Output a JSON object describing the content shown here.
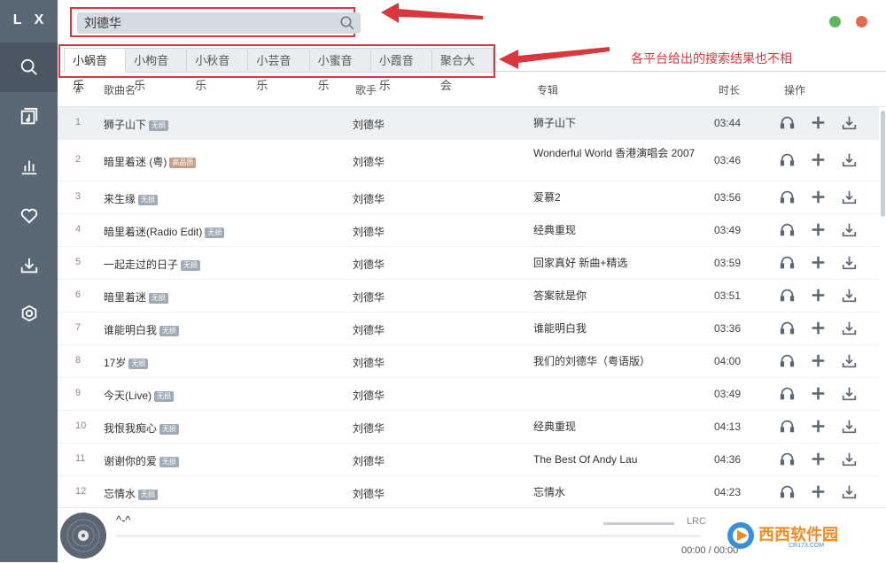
{
  "app": {
    "logo": "L X"
  },
  "search": {
    "value": "刘德华"
  },
  "tabs": [
    "小蜗音乐",
    "小枸音乐",
    "小秋音乐",
    "小芸音乐",
    "小蜜音乐",
    "小霞音乐",
    "聚合大会"
  ],
  "annotation": "各平台给出的搜索结果也不相",
  "table": {
    "headers": {
      "num": "#",
      "name": "歌曲名",
      "artist": "歌手",
      "album": "专辑",
      "time": "时长",
      "ops": "操作"
    },
    "rows": [
      {
        "num": "1",
        "name": "狮子山下",
        "badge": "无损",
        "artist": "刘德华",
        "album": "狮子山下",
        "time": "03:44"
      },
      {
        "num": "2",
        "name": "暗里着迷 (粤)",
        "badge": "高品质",
        "artist": "刘德华",
        "album": "Wonderful World 香港演唱会 2007",
        "time": "03:46"
      },
      {
        "num": "3",
        "name": "来生缘",
        "badge": "无损",
        "artist": "刘德华",
        "album": "爱慕2",
        "time": "03:56"
      },
      {
        "num": "4",
        "name": "暗里着迷(Radio Edit)",
        "badge": "无损",
        "artist": "刘德华",
        "album": "经典重现",
        "time": "03:49"
      },
      {
        "num": "5",
        "name": "一起走过的日子",
        "badge": "无损",
        "artist": "刘德华",
        "album": "回家真好 新曲+精选",
        "time": "03:59"
      },
      {
        "num": "6",
        "name": "暗里着迷",
        "badge": "无损",
        "artist": "刘德华",
        "album": "答案就是你",
        "time": "03:51"
      },
      {
        "num": "7",
        "name": "谁能明白我",
        "badge": "无损",
        "artist": "刘德华",
        "album": "谁能明白我",
        "time": "03:36"
      },
      {
        "num": "8",
        "name": "17岁",
        "badge": "无损",
        "artist": "刘德华",
        "album": "我们的刘德华（粤语版）",
        "time": "04:00"
      },
      {
        "num": "9",
        "name": "今天(Live)",
        "badge": "无损",
        "artist": "刘德华",
        "album": "",
        "time": "03:49"
      },
      {
        "num": "10",
        "name": "我恨我痴心",
        "badge": "无损",
        "artist": "刘德华",
        "album": "经典重现",
        "time": "04:13"
      },
      {
        "num": "11",
        "name": "谢谢你的爱",
        "badge": "无损",
        "artist": "刘德华",
        "album": "The Best Of Andy Lau",
        "time": "04:36"
      },
      {
        "num": "12",
        "name": "忘情水",
        "badge": "无损",
        "artist": "刘德华",
        "album": "忘情水",
        "time": "04:23"
      }
    ]
  },
  "player": {
    "title": "^-^",
    "lrc": "LRC",
    "time": "00:00 / 00:00"
  },
  "watermark": {
    "text": "西西软件园",
    "url": "CR173.COM"
  },
  "colors": {
    "sidebar": "#5a6875",
    "annotation": "#d9363e",
    "accent_green": "#5cb85c",
    "accent_red": "#e06c4e"
  },
  "icons": {
    "sidebar": [
      "search-icon",
      "music-list-icon",
      "chart-icon",
      "heart-icon",
      "download-icon",
      "settings-icon"
    ],
    "row_ops": [
      "headphones-icon",
      "plus-icon",
      "download-icon"
    ]
  }
}
